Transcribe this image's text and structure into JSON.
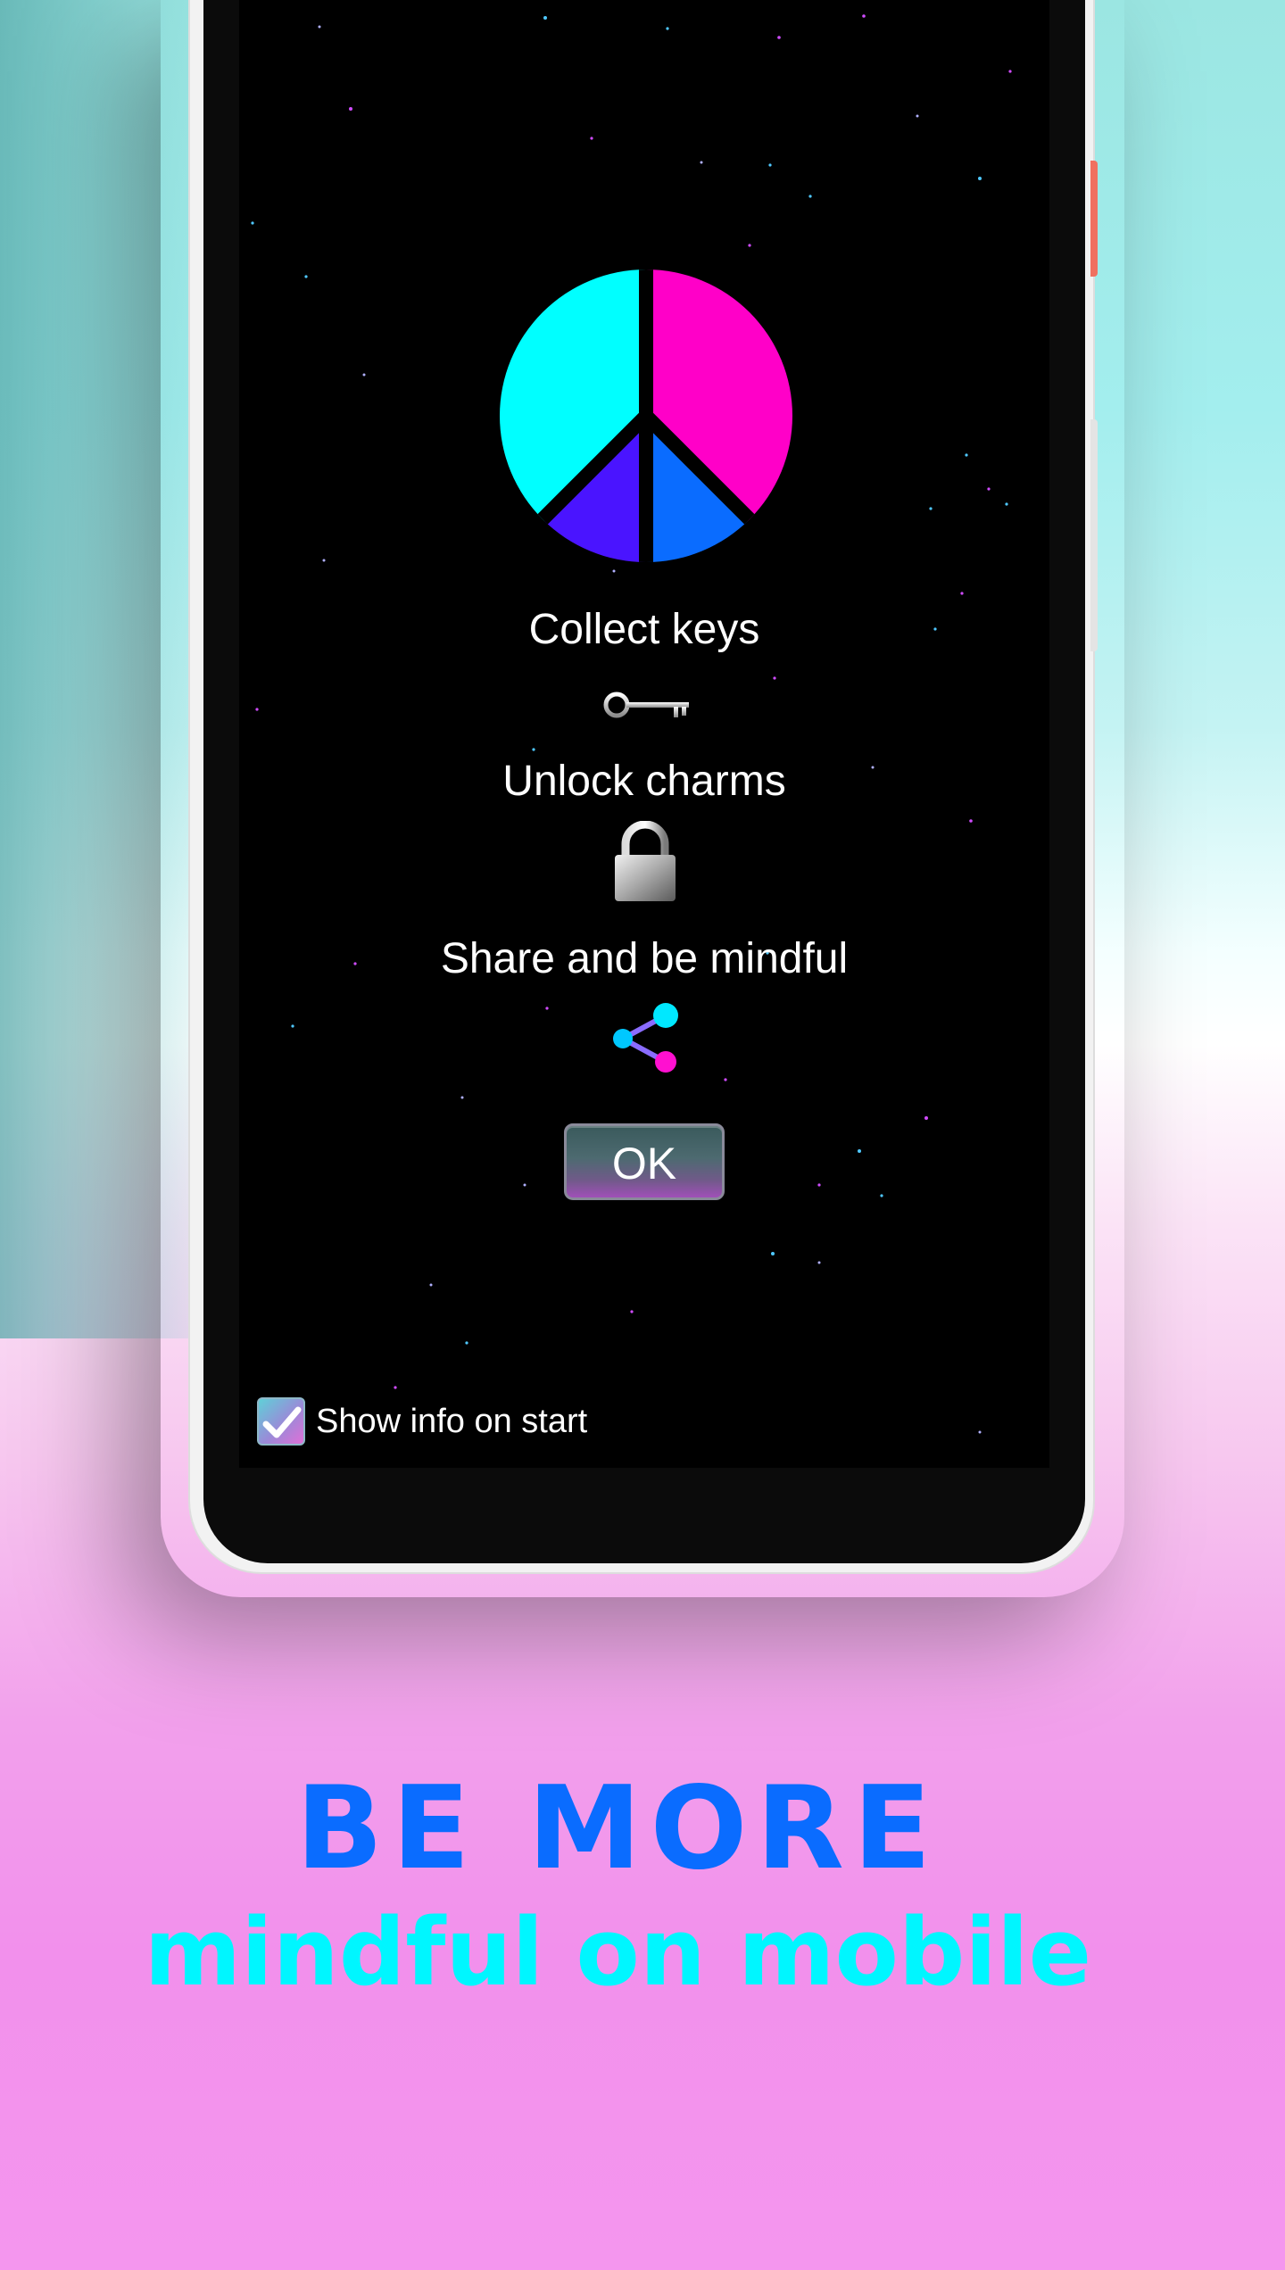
{
  "app": {
    "screen": {
      "info_lines": {
        "collect": "Collect keys",
        "unlock": "Unlock charms",
        "share": "Share and be mindful"
      },
      "icons": {
        "logo": "peace-sign-icon",
        "key": "key-icon",
        "lock": "lock-icon",
        "share": "share-icon"
      },
      "ok_label": "OK",
      "show_info_label": "Show info on start",
      "show_info_checked": true
    }
  },
  "promo": {
    "headline": "BE MORE",
    "subheadline": "mindful on mobile"
  },
  "colors": {
    "peace_cyan": "#00ffff",
    "peace_magenta": "#ff00c8",
    "peace_violet": "#4a14ff",
    "peace_blue": "#0a6cff",
    "headline_blue": "#0a6cff",
    "subheadline_cyan": "#00f6ff"
  }
}
